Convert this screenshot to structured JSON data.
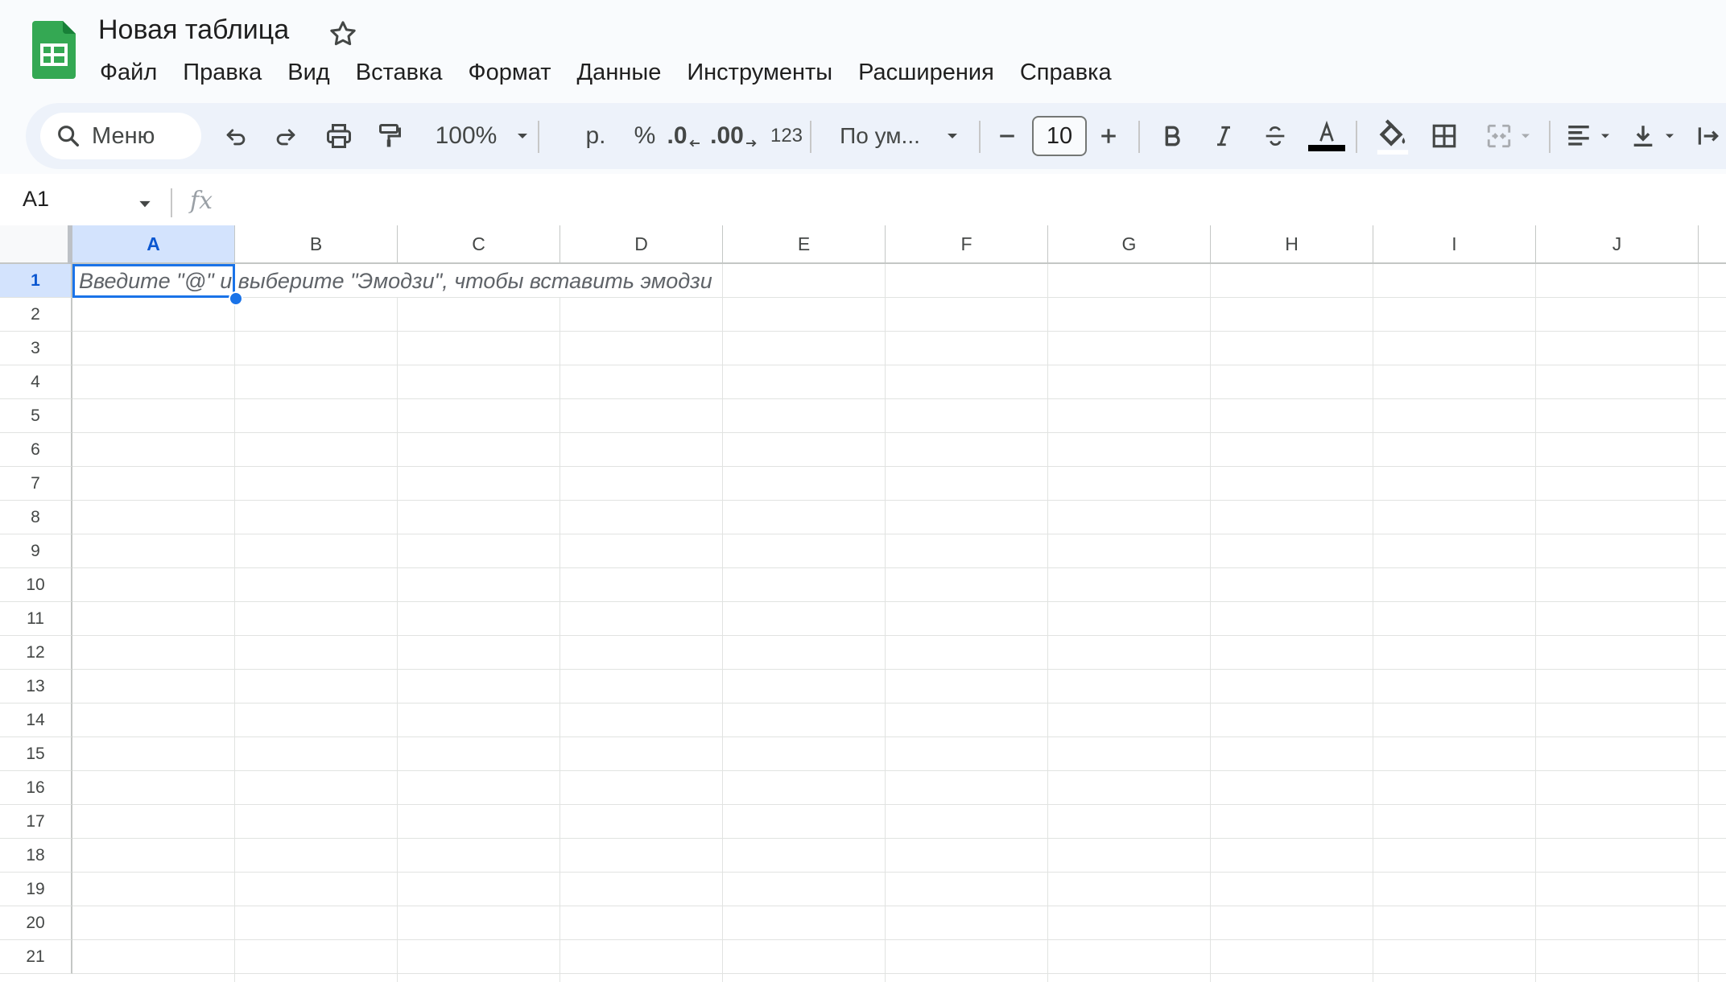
{
  "document": {
    "title": "Новая таблица"
  },
  "menu": [
    "Файл",
    "Правка",
    "Вид",
    "Вставка",
    "Формат",
    "Данные",
    "Инструменты",
    "Расширения",
    "Справка"
  ],
  "toolbar": {
    "search_label": "Меню",
    "zoom": "100%",
    "currency": "р.",
    "percent": "%",
    "decrease_decimal": ".0",
    "increase_decimal": ".00",
    "number_format": "123",
    "font_name": "По ум...",
    "font_size": "10",
    "text_color": "#000000"
  },
  "formula_bar": {
    "cell_ref": "A1",
    "fx_label": "fx"
  },
  "grid": {
    "columns": [
      "A",
      "B",
      "C",
      "D",
      "E",
      "F",
      "G",
      "H",
      "I",
      "J"
    ],
    "rows": [
      "1",
      "2",
      "3",
      "4",
      "5",
      "6",
      "7",
      "8",
      "9",
      "10",
      "11",
      "12",
      "13",
      "14",
      "15",
      "16",
      "17",
      "18",
      "19",
      "20",
      "21"
    ],
    "selected_cell": "A1",
    "placeholder": "Введите \"@\" и выберите \"Эмодзи\", чтобы вставить эмодзи"
  },
  "colors": {
    "accent": "#1a73e8",
    "header_bg": "#f9fbfd",
    "toolbar_bg": "#edf2fa",
    "selected_header": "#d3e3fd",
    "logo_green": "#34a853"
  }
}
